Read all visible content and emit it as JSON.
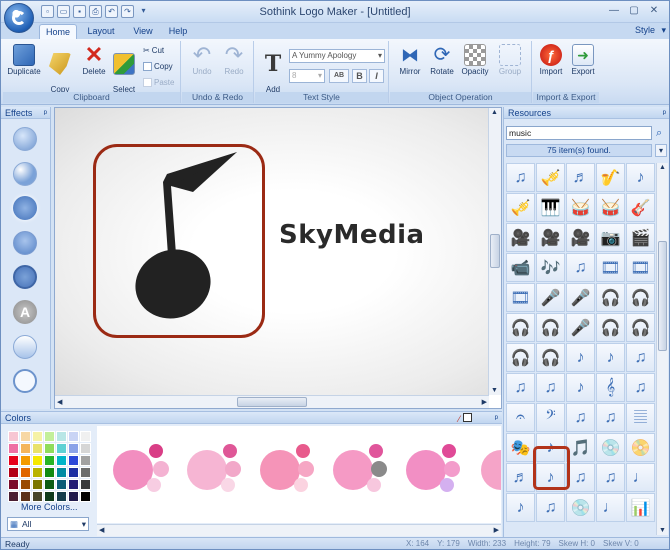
{
  "window": {
    "title": "Sothink Logo Maker - [Untitled]",
    "style_menu": "Style"
  },
  "tabs": [
    "Home",
    "Layout",
    "View",
    "Help"
  ],
  "ribbon": {
    "clipboard": {
      "label": "Clipboard",
      "duplicate": "Duplicate",
      "copy_format": "Copy\nFormat",
      "delete": "Delete",
      "select_all": "Select\nAll",
      "cut": "Cut",
      "copy": "Copy",
      "paste": "Paste"
    },
    "undo_redo": {
      "label": "Undo & Redo",
      "undo": "Undo",
      "redo": "Redo"
    },
    "text_style": {
      "label": "Text Style",
      "add_text": "Add\nText",
      "font": "A Yummy Apology",
      "size": "8",
      "ab": "AB",
      "bold": "B",
      "italic": "I"
    },
    "object_operation": {
      "label": "Object Operation",
      "mirror": "Mirror",
      "rotate": "Rotate",
      "opacity": "Opacity",
      "group": "Group"
    },
    "import_export": {
      "label": "Import & Export",
      "import": "Import",
      "export": "Export"
    }
  },
  "effects": {
    "title": "Effects",
    "pin": "ᵖ"
  },
  "canvas": {
    "logo_text": "SkyMedia",
    "colors": {
      "frame": "#9b2a14",
      "note": "#222222"
    }
  },
  "colors_panel": {
    "title": "Colors",
    "more_colors": "More Colors...",
    "filter": "All",
    "swatches": [
      "#f7c6d3",
      "#f7d7a4",
      "#f6f2a6",
      "#c3ef9a",
      "#b8e6e6",
      "#c9d4f5",
      "#f0f0f0",
      "#ee6fa4",
      "#f4b55a",
      "#e9e26a",
      "#8fdc5b",
      "#5fd1d4",
      "#8aa2e8",
      "#d6d6d6",
      "#e6001c",
      "#f39a00",
      "#f5e800",
      "#27b426",
      "#00b4c9",
      "#2a47d8",
      "#a2a2a2",
      "#b30017",
      "#e06600",
      "#b9b300",
      "#128a12",
      "#008aa2",
      "#1b2ea1",
      "#6d6d6d",
      "#7a0b2a",
      "#9a4b00",
      "#7a7600",
      "#0e5c14",
      "#0b5b77",
      "#231d76",
      "#3c3c3c",
      "#4a1f33",
      "#5e3218",
      "#49462a",
      "#0f3a1b",
      "#153d4c",
      "#201a4c",
      "#000000"
    ]
  },
  "resources": {
    "title": "Resources",
    "search": "music",
    "count": "75 item(s) found.",
    "icons": [
      "♫",
      "🎺",
      "♬",
      "🎷",
      "♪",
      "🎺",
      "🎹",
      "🥁",
      "🥁",
      "🎸",
      "🎥",
      "🎥",
      "🎥",
      "📷",
      "🎬",
      "📹",
      "🎶",
      "♫",
      "🎞",
      "🎞",
      "🎞",
      "🎤",
      "🎤",
      "🎧",
      "🎧",
      "🎧",
      "🎧",
      "🎤",
      "🎧",
      "🎧",
      "🎧",
      "🎧",
      "♪",
      "♪",
      "♫",
      "♫",
      "♫",
      "♪",
      "𝄞",
      "♫",
      "𝄐",
      "𝄢",
      "♫",
      "♫",
      "𝄚",
      "🎭",
      "♪",
      "🎵",
      "💿",
      "📀",
      "♬",
      "♪",
      "♫",
      "♫",
      "♩",
      "♪",
      "♫",
      "💿",
      "♩",
      "📊"
    ]
  },
  "status": {
    "text": "Ready",
    "x": "X: 164",
    "y": "Y: 179",
    "width": "Width: 233",
    "height": "Height: 79",
    "skew_h": "Skew H: 0",
    "skew_v": "Skew V: 0"
  }
}
